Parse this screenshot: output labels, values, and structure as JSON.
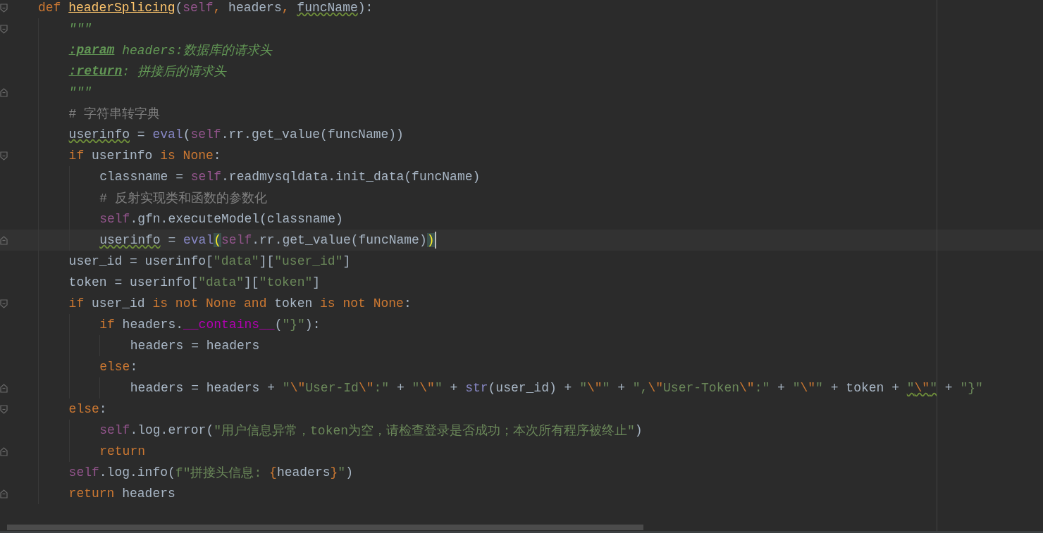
{
  "editor": {
    "lines": [
      {
        "kind": "fold-start",
        "current": false,
        "tokens": [
          {
            "kind": "kw",
            "text": "def "
          },
          {
            "kind": "fname",
            "text": "headerSplicing"
          },
          {
            "kind": "plain",
            "text": "("
          },
          {
            "kind": "self",
            "text": "self"
          },
          {
            "kind": "kw",
            "text": ", "
          },
          {
            "kind": "plain",
            "text": "headers"
          },
          {
            "kind": "kw",
            "text": ", "
          },
          {
            "kind": "plain",
            "text": "funcName",
            "warn": true
          },
          {
            "kind": "plain",
            "text": "):"
          }
        ],
        "children": [
          {
            "kind": "fold-start",
            "current": false,
            "tokens": [
              {
                "kind": "doc",
                "text": "\"\"\""
              }
            ]
          },
          {
            "kind": "line",
            "current": false,
            "tokens": [
              {
                "kind": "doctag",
                "text": ":param"
              },
              {
                "kind": "doc",
                "text": " headers:数据库的请求头"
              }
            ]
          },
          {
            "kind": "line",
            "current": false,
            "tokens": [
              {
                "kind": "doctag",
                "text": ":return"
              },
              {
                "kind": "doc",
                "text": ": 拼接后的请求头"
              }
            ]
          },
          {
            "kind": "fold-end",
            "current": false,
            "tokens": [
              {
                "kind": "doc",
                "text": "\"\"\""
              }
            ]
          },
          {
            "kind": "line",
            "current": false,
            "tokens": [
              {
                "kind": "comment",
                "text": "# 字符串转字典"
              }
            ]
          },
          {
            "kind": "line",
            "current": false,
            "tokens": [
              {
                "kind": "plain",
                "text": "userinfo",
                "warn": true
              },
              {
                "kind": "plain",
                "text": " = "
              },
              {
                "kind": "builtin",
                "text": "eval"
              },
              {
                "kind": "plain",
                "text": "("
              },
              {
                "kind": "self",
                "text": "self"
              },
              {
                "kind": "plain",
                "text": ".rr.get_value(funcName))"
              }
            ]
          },
          {
            "kind": "fold-start",
            "current": false,
            "tokens": [
              {
                "kind": "kw",
                "text": "if "
              },
              {
                "kind": "plain",
                "text": "userinfo "
              },
              {
                "kind": "kw",
                "text": "is None"
              },
              {
                "kind": "plain",
                "text": ":"
              }
            ],
            "children": [
              {
                "kind": "line",
                "current": false,
                "tokens": [
                  {
                    "kind": "plain",
                    "text": "classname = "
                  },
                  {
                    "kind": "self",
                    "text": "self"
                  },
                  {
                    "kind": "plain",
                    "text": ".readmysqldata.init_data(funcName)"
                  }
                ]
              },
              {
                "kind": "line",
                "current": false,
                "tokens": [
                  {
                    "kind": "comment",
                    "text": "# 反射实现类和函数的参数化"
                  }
                ]
              },
              {
                "kind": "line",
                "current": false,
                "tokens": [
                  {
                    "kind": "self",
                    "text": "self"
                  },
                  {
                    "kind": "plain",
                    "text": ".gfn.executeModel(classname)"
                  }
                ]
              },
              {
                "kind": "fold-end",
                "current": true,
                "tokens": [
                  {
                    "kind": "plain",
                    "text": "userinfo",
                    "warn": true
                  },
                  {
                    "kind": "plain",
                    "text": " = "
                  },
                  {
                    "kind": "builtin",
                    "text": "eval"
                  },
                  {
                    "kind": "match",
                    "text": "("
                  },
                  {
                    "kind": "self",
                    "text": "self"
                  },
                  {
                    "kind": "plain",
                    "text": ".rr.get_value(funcName)"
                  },
                  {
                    "kind": "match",
                    "text": ")"
                  }
                ]
              }
            ]
          },
          {
            "kind": "line",
            "current": false,
            "tokens": [
              {
                "kind": "plain",
                "text": "user_id = userinfo["
              },
              {
                "kind": "str",
                "text": "\"data\""
              },
              {
                "kind": "plain",
                "text": "]["
              },
              {
                "kind": "str",
                "text": "\"user_id\""
              },
              {
                "kind": "plain",
                "text": "]"
              }
            ]
          },
          {
            "kind": "line",
            "current": false,
            "tokens": [
              {
                "kind": "plain",
                "text": "token = userinfo["
              },
              {
                "kind": "str",
                "text": "\"data\""
              },
              {
                "kind": "plain",
                "text": "]["
              },
              {
                "kind": "str",
                "text": "\"token\""
              },
              {
                "kind": "plain",
                "text": "]"
              }
            ]
          },
          {
            "kind": "fold-start",
            "current": false,
            "tokens": [
              {
                "kind": "kw",
                "text": "if "
              },
              {
                "kind": "plain",
                "text": "user_id "
              },
              {
                "kind": "kw",
                "text": "is not None and "
              },
              {
                "kind": "plain",
                "text": "token "
              },
              {
                "kind": "kw",
                "text": "is not None"
              },
              {
                "kind": "plain",
                "text": ":"
              }
            ],
            "children": [
              {
                "kind": "line",
                "current": false,
                "tokens": [
                  {
                    "kind": "kw",
                    "text": "if "
                  },
                  {
                    "kind": "plain",
                    "text": "headers."
                  },
                  {
                    "kind": "magic",
                    "text": "__contains__"
                  },
                  {
                    "kind": "plain",
                    "text": "("
                  },
                  {
                    "kind": "str",
                    "text": "\"}\""
                  },
                  {
                    "kind": "plain",
                    "text": "):"
                  }
                ],
                "children": [
                  {
                    "kind": "line",
                    "current": false,
                    "tokens": [
                      {
                        "kind": "plain",
                        "text": "headers = headers"
                      }
                    ]
                  }
                ]
              },
              {
                "kind": "line",
                "current": false,
                "tokens": [
                  {
                    "kind": "kw",
                    "text": "else"
                  },
                  {
                    "kind": "plain",
                    "text": ":"
                  }
                ],
                "children": [
                  {
                    "kind": "fold-end",
                    "current": false,
                    "tokens": [
                      {
                        "kind": "plain",
                        "text": "headers = headers + "
                      },
                      {
                        "kind": "str",
                        "text": "\""
                      },
                      {
                        "kind": "esc",
                        "text": "\\\""
                      },
                      {
                        "kind": "str",
                        "text": "User-Id"
                      },
                      {
                        "kind": "esc",
                        "text": "\\\""
                      },
                      {
                        "kind": "str",
                        "text": ":\""
                      },
                      {
                        "kind": "plain",
                        "text": " + "
                      },
                      {
                        "kind": "str",
                        "text": "\""
                      },
                      {
                        "kind": "esc",
                        "text": "\\\""
                      },
                      {
                        "kind": "str",
                        "text": "\""
                      },
                      {
                        "kind": "plain",
                        "text": " + "
                      },
                      {
                        "kind": "builtin",
                        "text": "str"
                      },
                      {
                        "kind": "plain",
                        "text": "(user_id) + "
                      },
                      {
                        "kind": "str",
                        "text": "\""
                      },
                      {
                        "kind": "esc",
                        "text": "\\\""
                      },
                      {
                        "kind": "str",
                        "text": "\""
                      },
                      {
                        "kind": "plain",
                        "text": " + "
                      },
                      {
                        "kind": "str",
                        "text": "\","
                      },
                      {
                        "kind": "esc",
                        "text": "\\\""
                      },
                      {
                        "kind": "str",
                        "text": "User-Token"
                      },
                      {
                        "kind": "esc",
                        "text": "\\\""
                      },
                      {
                        "kind": "str",
                        "text": ":\""
                      },
                      {
                        "kind": "plain",
                        "text": " + "
                      },
                      {
                        "kind": "str",
                        "text": "\""
                      },
                      {
                        "kind": "esc",
                        "text": "\\\""
                      },
                      {
                        "kind": "str",
                        "text": "\""
                      },
                      {
                        "kind": "plain",
                        "text": " + token + "
                      },
                      {
                        "kind": "str",
                        "text": "\"",
                        "warn": true
                      },
                      {
                        "kind": "esc",
                        "text": "\\\"",
                        "warn": true
                      },
                      {
                        "kind": "str",
                        "text": "\"",
                        "warn": true
                      },
                      {
                        "kind": "plain",
                        "text": " + "
                      },
                      {
                        "kind": "str",
                        "text": "\"}\""
                      }
                    ]
                  }
                ]
              }
            ]
          },
          {
            "kind": "fold-start",
            "current": false,
            "tokens": [
              {
                "kind": "kw",
                "text": "else"
              },
              {
                "kind": "plain",
                "text": ":"
              }
            ],
            "children": [
              {
                "kind": "line",
                "current": false,
                "tokens": [
                  {
                    "kind": "self",
                    "text": "self"
                  },
                  {
                    "kind": "plain",
                    "text": ".log.error("
                  },
                  {
                    "kind": "str",
                    "text": "\"用户信息异常，token为空，请检查登录是否成功；本次所有程序被终止\""
                  },
                  {
                    "kind": "plain",
                    "text": ")"
                  }
                ]
              },
              {
                "kind": "fold-end",
                "current": false,
                "tokens": [
                  {
                    "kind": "kw",
                    "text": "return"
                  }
                ]
              }
            ]
          },
          {
            "kind": "line",
            "current": false,
            "tokens": [
              {
                "kind": "self",
                "text": "self"
              },
              {
                "kind": "plain",
                "text": ".log.info("
              },
              {
                "kind": "str",
                "text": "f\"拼接头信息: "
              },
              {
                "kind": "fbrace",
                "text": "{"
              },
              {
                "kind": "plain",
                "text": "headers"
              },
              {
                "kind": "fbrace",
                "text": "}"
              },
              {
                "kind": "str",
                "text": "\""
              },
              {
                "kind": "plain",
                "text": ")"
              }
            ]
          },
          {
            "kind": "fold-end",
            "current": false,
            "tokens": [
              {
                "kind": "kw",
                "text": "return "
              },
              {
                "kind": "plain",
                "text": "headers"
              }
            ]
          }
        ]
      }
    ]
  }
}
